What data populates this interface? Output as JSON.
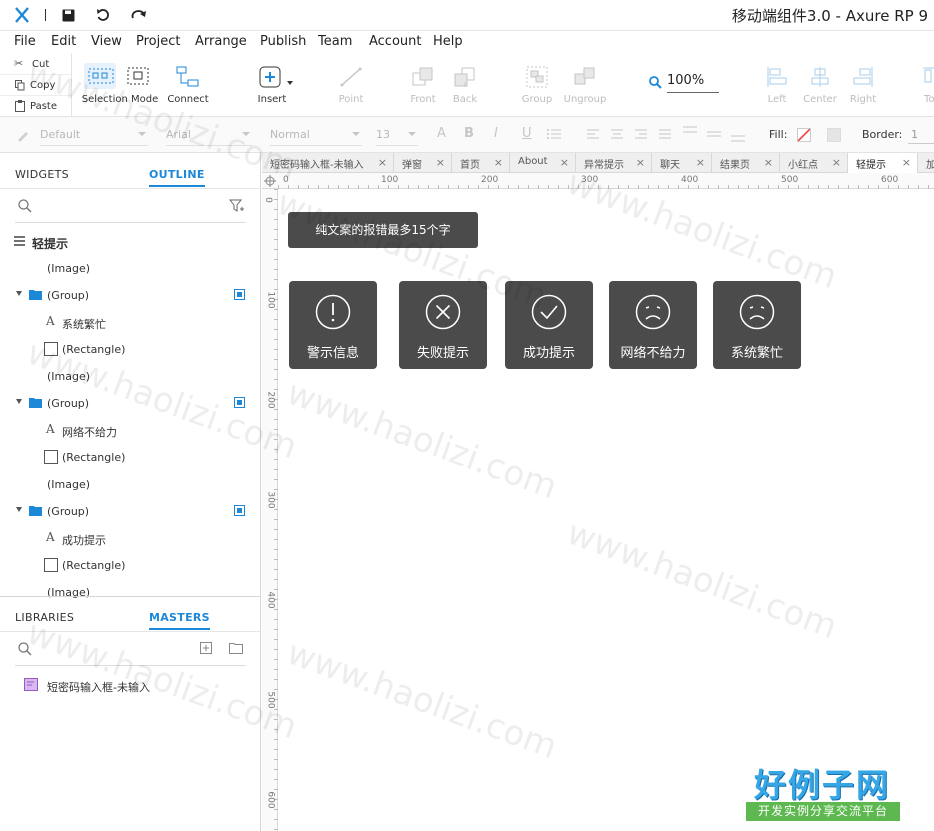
{
  "app": {
    "title": "移动端组件3.0 - Axure RP 9"
  },
  "menu": [
    "File",
    "Edit",
    "View",
    "Project",
    "Arrange",
    "Publish",
    "Team",
    "Account",
    "Help"
  ],
  "clipboard": {
    "cut": "Cut",
    "copy": "Copy",
    "paste": "Paste"
  },
  "toolbar": {
    "selection_mode": "Selection Mode",
    "connect": "Connect",
    "insert": "Insert",
    "point": "Point",
    "front": "Front",
    "back": "Back",
    "group": "Group",
    "ungroup": "Ungroup",
    "zoom": "100%",
    "left": "Left",
    "center": "Center",
    "right": "Right",
    "top": "To"
  },
  "format": {
    "style": "Default",
    "font": "Arial",
    "weight": "Normal",
    "size": "13",
    "fill_label": "Fill:",
    "border_label": "Border:",
    "border_value": "1"
  },
  "left_panel": {
    "tab_widgets": "WIDGETS",
    "tab_outline": "OUTLINE",
    "outline": [
      {
        "label": "轻提示",
        "kind": "page"
      },
      {
        "label": "(Image)",
        "kind": "image"
      },
      {
        "label": "(Group)",
        "kind": "group"
      },
      {
        "label": "系统繁忙",
        "kind": "text"
      },
      {
        "label": "(Rectangle)",
        "kind": "rect"
      },
      {
        "label": "(Image)",
        "kind": "image"
      },
      {
        "label": "(Group)",
        "kind": "group"
      },
      {
        "label": "网络不给力",
        "kind": "text"
      },
      {
        "label": "(Rectangle)",
        "kind": "rect"
      },
      {
        "label": "(Image)",
        "kind": "image"
      },
      {
        "label": "(Group)",
        "kind": "group"
      },
      {
        "label": "成功提示",
        "kind": "text"
      },
      {
        "label": "(Rectangle)",
        "kind": "rect"
      },
      {
        "label": "(Image)",
        "kind": "image"
      }
    ],
    "tab_libraries": "LIBRARIES",
    "tab_masters": "MASTERS",
    "masters": [
      "短密码输入框-未输入"
    ]
  },
  "doc_tabs": [
    "短密码输入框-未输入",
    "弹窗",
    "首页",
    "About",
    "异常提示",
    "聊天",
    "结果页",
    "小红点",
    "轻提示",
    "加"
  ],
  "active_tab": "轻提示",
  "h_ruler": [
    "0",
    "100",
    "200",
    "300",
    "400",
    "500",
    "600"
  ],
  "v_ruler": [
    "0",
    "100",
    "200",
    "300",
    "400",
    "500",
    "600"
  ],
  "canvas": {
    "tip_text": "纯文案的报错最多15个字",
    "cards": [
      {
        "label": "警示信息",
        "icon": "warning-icon"
      },
      {
        "label": "失败提示",
        "icon": "fail-icon"
      },
      {
        "label": "成功提示",
        "icon": "success-icon"
      },
      {
        "label": "网络不给力",
        "icon": "sad-face-icon"
      },
      {
        "label": "系统繁忙",
        "icon": "sad-face-icon"
      }
    ]
  },
  "watermark": {
    "text": "www.haolizi.com",
    "logo": "好例子网",
    "logo_sub": "开发实例分享交流平台"
  },
  "colors": {
    "accent": "#1e88d8",
    "card_bg": "#4b4b4b",
    "logo": "#35a6e6",
    "logo_sub_bg": "#5cb84f"
  }
}
